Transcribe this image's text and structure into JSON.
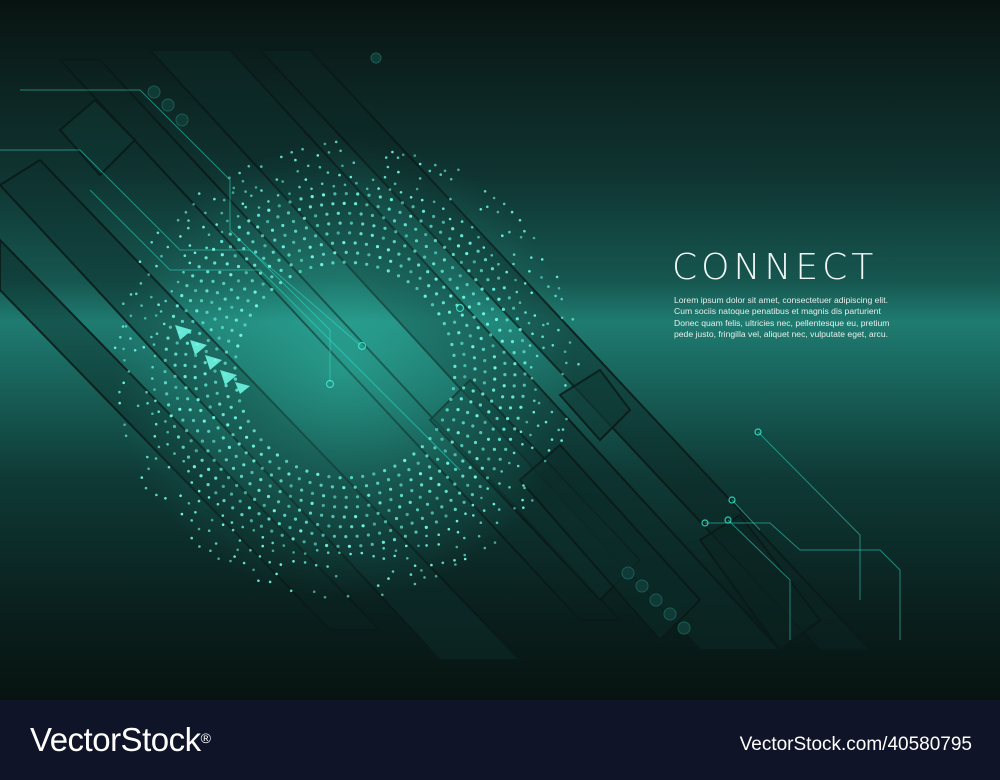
{
  "artwork": {
    "headline": "CONNECT",
    "body_lines": [
      "Lorem ipsum dolor sit amet, consectetuer adipiscing elit.",
      "Cum sociis natoque penatibus et magnis dis parturient",
      "Donec quam felis, ultricies nec, pellentesque eu, pretium",
      "pede justo, fringilla vel, aliquet nec, vulputate eget, arcu."
    ]
  },
  "footer": {
    "brand": "VectorStock",
    "brand_mark": "®",
    "image_id": "VectorStock.com/40580795"
  },
  "colors": {
    "teal_glow": "#3ff0d6",
    "teal_band": "#1f7b71",
    "dark_bg": "#081311",
    "footer_bg": "#101428",
    "text": "#f2f7f6"
  }
}
